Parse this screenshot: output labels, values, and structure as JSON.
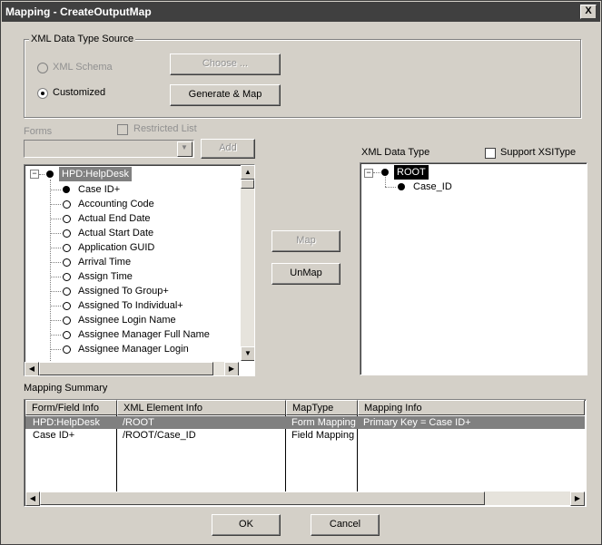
{
  "window": {
    "title": "Mapping - CreateOutputMap",
    "close_glyph": "X"
  },
  "xml_source": {
    "legend": "XML Data Type Source",
    "xml_schema_label": "XML Schema",
    "customized_label": "Customized",
    "selected": "Customized",
    "choose_button": "Choose ...",
    "generate_button": "Generate & Map"
  },
  "forms": {
    "label": "Forms",
    "restricted_label": "Restricted List",
    "restricted_checked": false,
    "combo_value": "",
    "add_button": "Add"
  },
  "form_tree": {
    "root": "HPD:HelpDesk",
    "items": [
      {
        "label": "Case ID+",
        "filled": true
      },
      {
        "label": "Accounting Code",
        "filled": false
      },
      {
        "label": "Actual End Date",
        "filled": false
      },
      {
        "label": "Actual Start Date",
        "filled": false
      },
      {
        "label": "Application GUID",
        "filled": false
      },
      {
        "label": "Arrival Time",
        "filled": false
      },
      {
        "label": "Assign Time",
        "filled": false
      },
      {
        "label": "Assigned To Group+",
        "filled": false
      },
      {
        "label": "Assigned To Individual+",
        "filled": false
      },
      {
        "label": "Assignee Login Name",
        "filled": false
      },
      {
        "label": "Assignee Manager Full Name",
        "filled": false
      },
      {
        "label": "Assignee Manager Login",
        "filled": false
      }
    ]
  },
  "actions": {
    "map_button": "Map",
    "unmap_button": "UnMap"
  },
  "xml_tree": {
    "label": "XML Data Type",
    "support_xsi_label": "Support XSIType",
    "support_xsi_checked": false,
    "root": "ROOT",
    "children": [
      "Case_ID"
    ]
  },
  "summary": {
    "label": "Mapping Summary",
    "columns": [
      "Form/Field Info",
      "XML Element Info",
      "MapType",
      "Mapping Info"
    ],
    "rows": [
      {
        "form_field": "HPD:HelpDesk",
        "xml_element": "/ROOT",
        "map_type": "Form Mapping",
        "mapping_info": "Primary Key = Case ID+",
        "selected": true
      },
      {
        "form_field": "Case ID+",
        "xml_element": "/ROOT/Case_ID",
        "map_type": "Field Mapping",
        "mapping_info": "",
        "selected": false
      }
    ]
  },
  "footer": {
    "ok_button": "OK",
    "cancel_button": "Cancel"
  },
  "icons": {
    "scroll_up": "▲",
    "scroll_down": "▼",
    "scroll_left": "◀",
    "scroll_right": "▶",
    "combo_arrow": "▼",
    "expander_minus": "−"
  }
}
